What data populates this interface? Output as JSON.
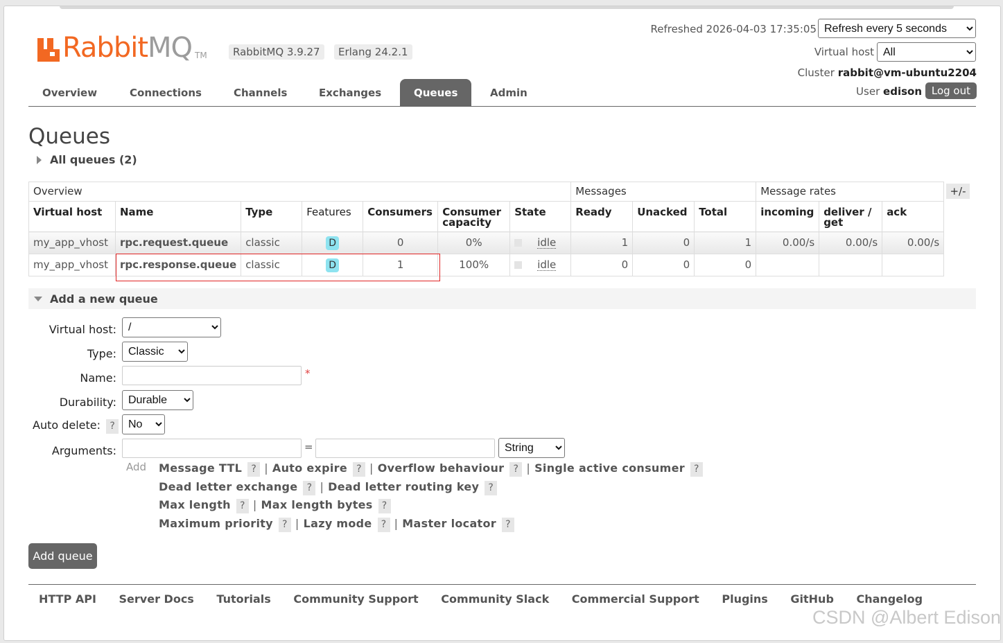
{
  "header": {
    "logo_text_rabbit": "Rabbit",
    "logo_text_mq": "MQ",
    "logo_tm": "TM",
    "rabbitmq_version": "RabbitMQ 3.9.27",
    "erlang_version": "Erlang 24.2.1",
    "refreshed": "Refreshed 2026-04-03 17:35:05",
    "refresh_select": "Refresh every 5 seconds",
    "virtual_host_label": "Virtual host",
    "virtual_host_select": "All",
    "cluster_label": "Cluster",
    "cluster_name": "rabbit@vm-ubuntu2204",
    "user_label": "User",
    "user_name": "edison",
    "logout": "Log out"
  },
  "tabs": [
    {
      "label": "Overview"
    },
    {
      "label": "Connections"
    },
    {
      "label": "Channels"
    },
    {
      "label": "Exchanges"
    },
    {
      "label": "Queues",
      "active": true
    },
    {
      "label": "Admin"
    }
  ],
  "page": {
    "title": "Queues",
    "all_queues": "All queues (2)",
    "plus_minus": "+/-"
  },
  "table": {
    "groups": {
      "overview": "Overview",
      "messages": "Messages",
      "rates": "Message rates"
    },
    "columns": {
      "vhost": "Virtual host",
      "name": "Name",
      "type": "Type",
      "features": "Features",
      "consumers": "Consumers",
      "capacity_1": "Consumer",
      "capacity_2": "capacity",
      "state": "State",
      "ready": "Ready",
      "unacked": "Unacked",
      "total": "Total",
      "incoming": "incoming",
      "deliver_1": "deliver /",
      "deliver_2": "get",
      "ack": "ack"
    },
    "rows": [
      {
        "vhost": "my_app_vhost",
        "name": "rpc.request.queue",
        "type": "classic",
        "feature": "D",
        "consumers": "0",
        "capacity": "0%",
        "state": "idle",
        "ready": "1",
        "unacked": "0",
        "total": "1",
        "incoming": "0.00/s",
        "deliver": "0.00/s",
        "ack": "0.00/s"
      },
      {
        "vhost": "my_app_vhost",
        "name": "rpc.response.queue",
        "type": "classic",
        "feature": "D",
        "consumers": "1",
        "capacity": "100%",
        "state": "idle",
        "ready": "0",
        "unacked": "0",
        "total": "0",
        "incoming": "",
        "deliver": "",
        "ack": ""
      }
    ]
  },
  "add_queue": {
    "heading": "Add a new queue",
    "vhost_label": "Virtual host:",
    "vhost_value": "/",
    "type_label": "Type:",
    "type_value": "Classic",
    "name_label": "Name:",
    "required_mark": "*",
    "durability_label": "Durability:",
    "durability_value": "Durable",
    "autodelete_label": "Auto delete:",
    "autodelete_value": "No",
    "help_mark": "?",
    "arguments_label": "Arguments:",
    "equals": "=",
    "arg_type_value": "String",
    "add_link": "Add",
    "arg_shortcuts": {
      "message_ttl": "Message TTL",
      "auto_expire": "Auto expire",
      "overflow": "Overflow behaviour",
      "single_active": "Single active consumer",
      "dlx": "Dead letter exchange",
      "dlrk": "Dead letter routing key",
      "max_length": "Max length",
      "max_length_bytes": "Max length bytes",
      "max_priority": "Maximum priority",
      "lazy_mode": "Lazy mode",
      "master_locator": "Master locator"
    },
    "sep": "|",
    "submit": "Add queue"
  },
  "footer": [
    "HTTP API",
    "Server Docs",
    "Tutorials",
    "Community Support",
    "Community Slack",
    "Commercial Support",
    "Plugins",
    "GitHub",
    "Changelog"
  ],
  "watermark": "CSDN @Albert Edison",
  "colors": {
    "brand": "#f26822",
    "tab_active": "#666666",
    "feature_badge": "#8ee3f0",
    "highlight": "#e02424"
  }
}
